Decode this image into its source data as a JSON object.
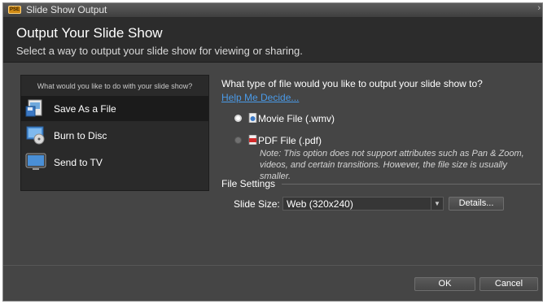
{
  "window": {
    "app_icon": "app-logo-icon",
    "title": "Slide Show Output",
    "close_glyph": "›"
  },
  "header": {
    "title": "Output Your Slide Show",
    "subtitle": "Select a way to output your slide show for viewing or sharing."
  },
  "left_panel": {
    "question": "What would you like to do with your slide show?",
    "options": [
      {
        "label": "Save As a File",
        "icon": "save-file-icon",
        "selected": true
      },
      {
        "label": "Burn to Disc",
        "icon": "burn-disc-icon",
        "selected": false
      },
      {
        "label": "Send to TV",
        "icon": "tv-icon",
        "selected": false
      }
    ]
  },
  "right_panel": {
    "question": "What type of file would you like to output your slide show to?",
    "help_link": "Help Me Decide...",
    "file_types": [
      {
        "label": "Movie File (.wmv)",
        "icon": "movie-file-icon",
        "selected": true
      },
      {
        "label": "PDF File (.pdf)",
        "icon": "pdf-file-icon",
        "selected": false
      }
    ],
    "pdf_note": "Note: This option does not support attributes such as Pan & Zoom, videos, and certain transitions. However, the file size is usually smaller."
  },
  "file_settings": {
    "label": "File Settings",
    "slide_size_label": "Slide Size:",
    "slide_size_value": "Web (320x240)",
    "details_button": "Details..."
  },
  "footer": {
    "ok_button": "OK",
    "cancel_button": "Cancel"
  },
  "colors": {
    "link": "#4a9ae8",
    "dialog_bg": "#454545",
    "panel_bg": "#2a2a2a"
  }
}
